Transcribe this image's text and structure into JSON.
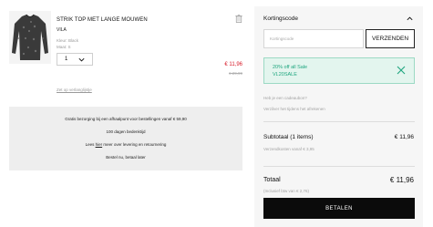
{
  "product": {
    "name": "STRIK TOP MET LANGE MOUWEN",
    "brand": "VILA",
    "color": "Kleur: Black",
    "size": "Maat: S",
    "quantity": "1",
    "price_sale": "€ 11,96",
    "price_old": "€ 29,99",
    "wishlist_link": "Zet op verlanglijstje",
    "image_icon": "knit-top-thumbnail"
  },
  "info": {
    "shipping": "Gratis bezorging bij een afhaalpunt voor bestellingen vanaf € 59,90",
    "returns": "100 dagen bedenktijd",
    "more_prefix": "Lees ",
    "more_link": "hier",
    "more_suffix": " meer over levering en retournering",
    "pay_later": "Bestel nu, betaal later"
  },
  "summary": {
    "discount_title": "Kortingscode",
    "code_placeholder": "Kortingscode",
    "code_button": "VERZENDEN",
    "applied_title": "20% off all Sale",
    "applied_code": "VL20SALE",
    "gift_question": "Heb je een cadeaubon?",
    "gift_answer": "Verzilver het tijdens het afrekenen",
    "subtotal_label": "Subtotaal (1 items)",
    "subtotal_value": "€ 11,96",
    "shipping_note": "Verzendkosten vanaf € 3,95",
    "total_label": "Totaal",
    "total_value": "€ 11,96",
    "vat_note": "(Inclusief btw van € 2,76)",
    "pay_button": "BETALEN"
  },
  "colors": {
    "sale_red": "#d81e2c",
    "success_green": "#1fa67f",
    "success_bg": "#e3f5ee",
    "pay_black": "#0b0b0b"
  }
}
